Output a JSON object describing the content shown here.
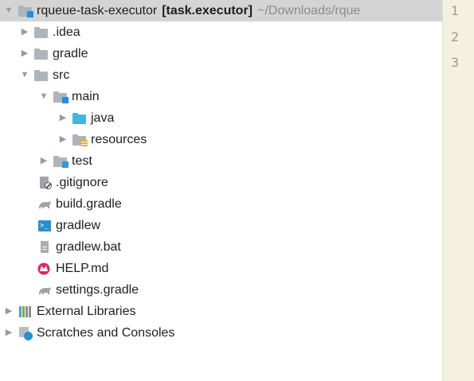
{
  "project_tree": {
    "root": {
      "name": "rqueue-task-executor",
      "module": "[task.executor]",
      "path": "~/Downloads/rque"
    },
    "items": [
      {
        "label": ".idea"
      },
      {
        "label": "gradle"
      },
      {
        "label": "src"
      },
      {
        "label": "main"
      },
      {
        "label": "java"
      },
      {
        "label": "resources"
      },
      {
        "label": "test"
      },
      {
        "label": ".gitignore"
      },
      {
        "label": "build.gradle"
      },
      {
        "label": "gradlew"
      },
      {
        "label": "gradlew.bat"
      },
      {
        "label": "HELP.md"
      },
      {
        "label": "settings.gradle"
      },
      {
        "label": "External Libraries"
      },
      {
        "label": "Scratches and Consoles"
      }
    ]
  },
  "editor": {
    "line_numbers": [
      "1",
      "2",
      "3"
    ]
  },
  "colors": {
    "selection": "#d4d4d4",
    "folder_gray": "#aeb4bb",
    "folder_blue": "#40b6e0",
    "module_badge": "#1e90e6",
    "gutter": "#f4f1de"
  },
  "icons": {
    "root": "module-folder-icon",
    ".idea": "folder-icon",
    "gradle": "folder-icon",
    "src": "folder-icon",
    "main": "source-root-folder-icon",
    "java": "java-folder-icon",
    "resources": "resources-folder-icon",
    "test": "test-folder-icon",
    ".gitignore": "gitignore-file-icon",
    "build.gradle": "gradle-file-icon",
    "gradlew": "shell-script-icon",
    "gradlew.bat": "bat-file-icon",
    "HELP.md": "markdown-file-icon",
    "settings.gradle": "gradle-file-icon",
    "External Libraries": "libraries-icon",
    "Scratches and Consoles": "scratches-icon"
  }
}
